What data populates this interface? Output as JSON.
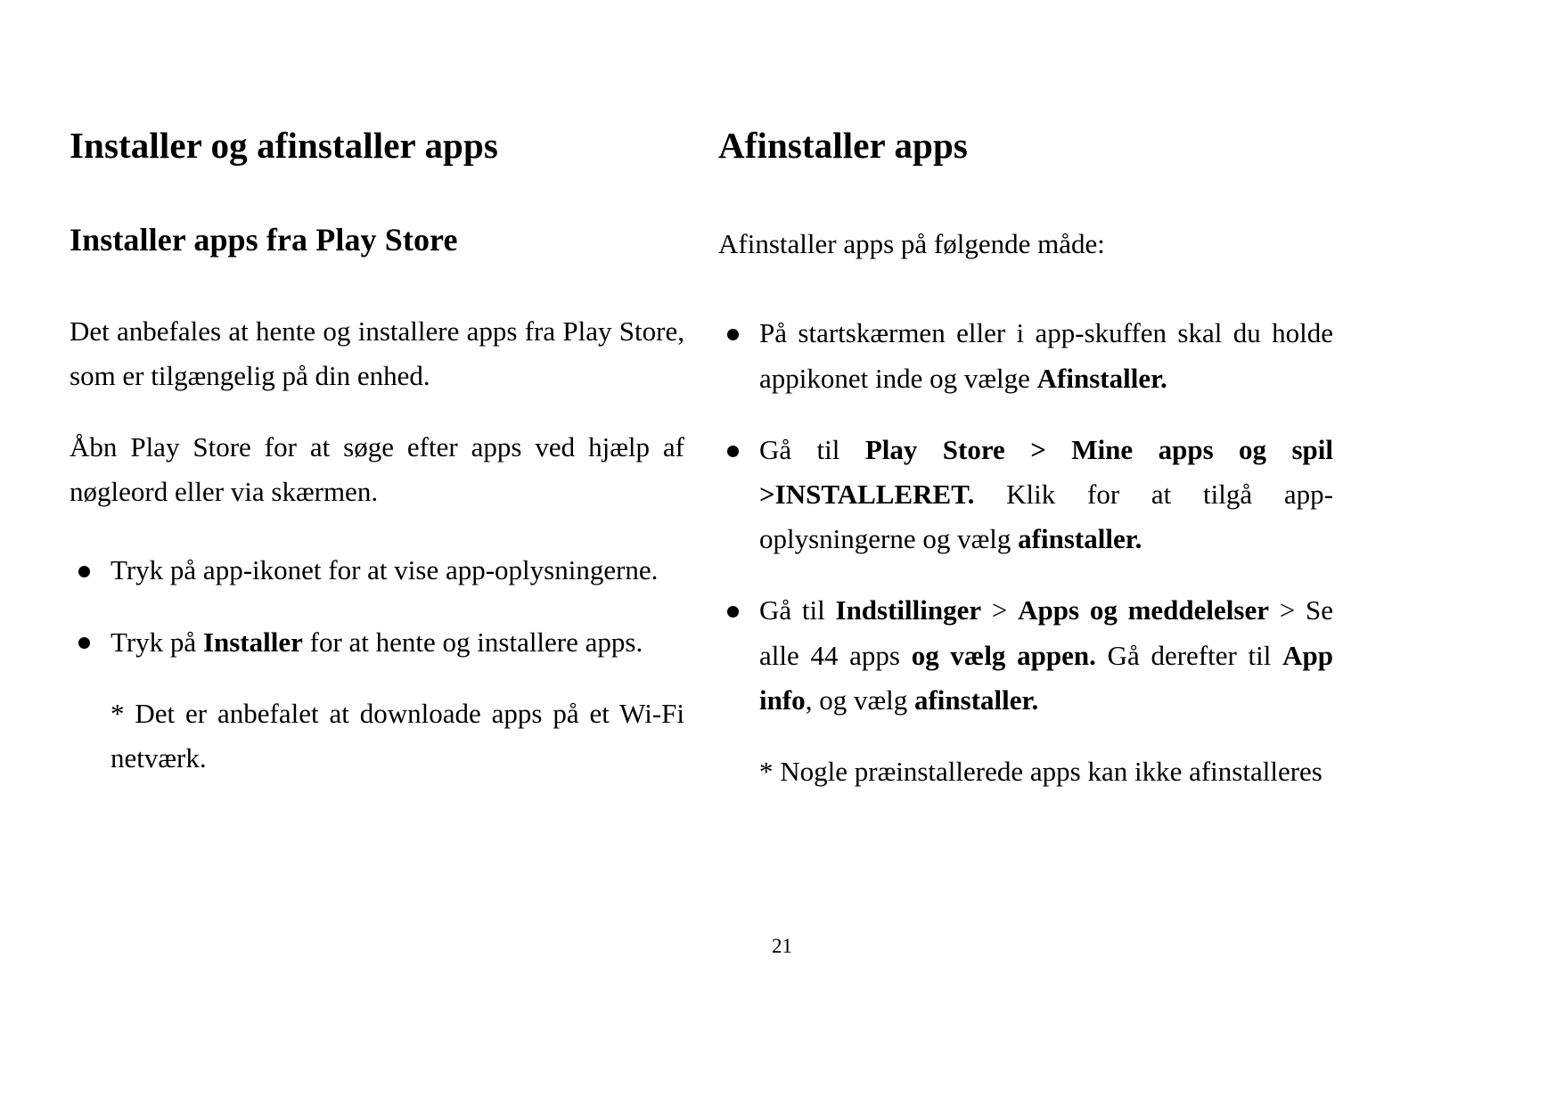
{
  "document": {
    "page_number": "21",
    "language": "da"
  },
  "left_column": {
    "title": "Installer og afinstaller apps",
    "subtitle": "Installer apps fra Play Store",
    "paragraphs": [
      "Det anbefales at hente og installere apps fra Play Store, som er tilgængelig på din enhed.",
      "Åbn Play Store for at søge efter apps ved hjælp af nøgleord eller via skærmen."
    ],
    "bullets": [
      {
        "text_before": "Tryk på app-ikonet for at vise app-oplysningerne.",
        "bold": "",
        "text_after": ""
      },
      {
        "text_before": "Tryk på ",
        "bold": "Installer",
        "text_after": " for at hente og installere apps."
      }
    ],
    "note": "* Det er anbefalet at downloade apps på et Wi-Fi netværk."
  },
  "right_column": {
    "title": "Afinstaller apps",
    "intro": "Afinstaller apps på følgende måde:",
    "bullets": [
      {
        "part1": "På startskærmen eller i app-skuffen skal du holde appikonet inde og vælge ",
        "bold1": "Afinstaller.",
        "part2": "",
        "bold2": "",
        "part3": ""
      },
      {
        "part1": "Gå til ",
        "bold1": "Play Store > Mine apps og spil >INSTALLERET.",
        "part2": " Klik for at tilgå app-oplysningerne og vælg ",
        "bold2": "afinstaller.",
        "part3": ""
      },
      {
        "part1": "Gå til ",
        "bold1": "Indstillinger",
        "part2": " > ",
        "bold2": "Apps og meddelelser",
        "part3": " > Se alle 44 apps ",
        "bold3": "og vælg appen.",
        "part4": " Gå derefter til ",
        "bold4": "App info",
        "part5": ", og vælg ",
        "bold5": "afinstaller.",
        "part6": ""
      }
    ],
    "note": "* Nogle præinstallerede apps kan ikke afinstalleres"
  }
}
